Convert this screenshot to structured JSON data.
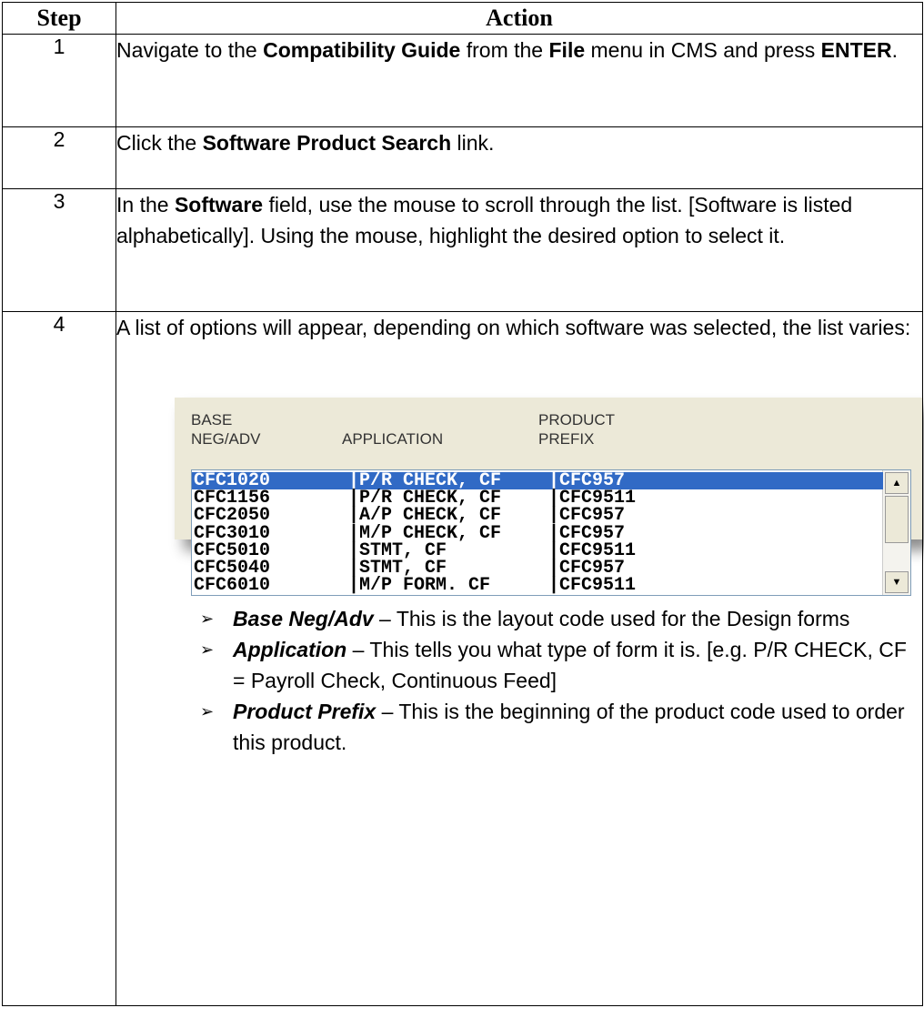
{
  "table": {
    "header": {
      "step": "Step",
      "action": "Action"
    },
    "step1": {
      "num": "1",
      "t1": "Navigate to the ",
      "b1": "Compatibility Guide",
      "t2": " from the ",
      "b2": "File",
      "t3": " menu in CMS and press ",
      "b3": "ENTER",
      "t4": "."
    },
    "step2": {
      "num": "2",
      "t1": "Click the ",
      "b1": "Software Product Search",
      "t2": " link."
    },
    "step3": {
      "num": "3",
      "t1": "In the ",
      "b1": "Software",
      "t2": " field, use the mouse to scroll through the list. [Software is listed alphabetically]. Using the mouse, highlight the desired option to select it."
    },
    "step4": {
      "num": "4",
      "intro": "A list of options will appear, depending on which software was selected, the list varies:"
    }
  },
  "listbox": {
    "headers": {
      "col1_line1": "BASE",
      "col1_line2": "NEG/ADV",
      "col2": "APPLICATION",
      "col3_line1": "PRODUCT",
      "col3_line2": "PREFIX"
    },
    "rows": [
      {
        "base": "CFC1020",
        "app": "|P/R CHECK, CF",
        "prefix": "|CFC957"
      },
      {
        "base": "CFC1156",
        "app": "|P/R CHECK, CF",
        "prefix": "|CFC9511"
      },
      {
        "base": "CFC2050",
        "app": "|A/P CHECK, CF",
        "prefix": "|CFC957"
      },
      {
        "base": "CFC3010",
        "app": "|M/P CHECK, CF",
        "prefix": "|CFC957"
      },
      {
        "base": "CFC5010",
        "app": "|STMT, CF",
        "prefix": "|CFC9511"
      },
      {
        "base": "CFC5040",
        "app": "|STMT, CF",
        "prefix": "|CFC957"
      },
      {
        "base": "CFC6010",
        "app": "|M/P FORM. CF",
        "prefix": "|CFC9511"
      }
    ],
    "scroll_up": "▲",
    "scroll_down": "▼"
  },
  "bullets": [
    {
      "term": "Base Neg/Adv",
      "text": " – This is the layout code used for the Design forms"
    },
    {
      "term": "Application",
      "text": " – This tells you what type of form it is. [e.g. P/R CHECK, CF = Payroll Check, Continuous Feed]"
    },
    {
      "term": "Product Prefix",
      "text": " – This is the beginning of the product code used to order this product."
    }
  ],
  "bullet_marker": "➢"
}
